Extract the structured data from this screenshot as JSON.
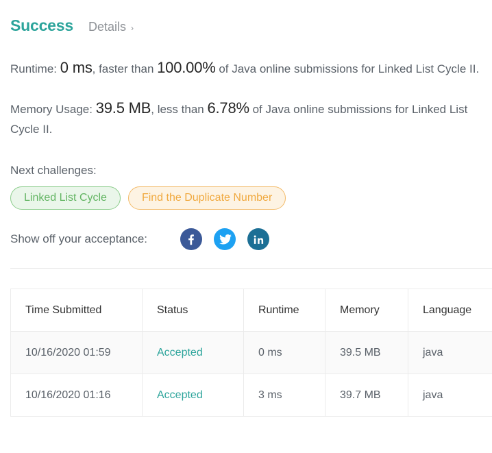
{
  "header": {
    "status": "Success",
    "details_label": "Details",
    "chevron": "›"
  },
  "stats": {
    "runtime": {
      "label": "Runtime:",
      "value": "0 ms",
      "comparator": ", faster than ",
      "percent": "100.00%",
      "suffix": " of Java online submissions for Linked List Cycle II."
    },
    "memory": {
      "label": "Memory Usage:",
      "value": "39.5 MB",
      "comparator": ", less than ",
      "percent": "6.78%",
      "suffix": " of Java online submissions for Linked List Cycle II."
    }
  },
  "next_challenges": {
    "label": "Next challenges:",
    "items": [
      {
        "label": "Linked List Cycle",
        "color": "#63b563",
        "border": "#8ccd8c",
        "background": "#eaf6ea"
      },
      {
        "label": "Find the Duplicate Number",
        "color": "#f0a93f",
        "border": "#f3bb6a",
        "background": "#fdf3e3"
      }
    ]
  },
  "share": {
    "label": "Show off your acceptance:",
    "networks": [
      {
        "name": "facebook-icon",
        "color": "#3b5998"
      },
      {
        "name": "twitter-icon",
        "color": "#1da1f2"
      },
      {
        "name": "linkedin-icon",
        "color": "#1c6f95"
      }
    ]
  },
  "table": {
    "columns": [
      "Time Submitted",
      "Status",
      "Runtime",
      "Memory",
      "Language"
    ],
    "rows": [
      {
        "time": "10/16/2020 01:59",
        "status": "Accepted",
        "runtime": "0 ms",
        "memory": "39.5 MB",
        "language": "java"
      },
      {
        "time": "10/16/2020 01:16",
        "status": "Accepted",
        "runtime": "3 ms",
        "memory": "39.7 MB",
        "language": "java"
      }
    ]
  },
  "colors": {
    "accent_teal": "#2ca49b",
    "body_text": "#5a6169",
    "strong_text": "#262626",
    "muted": "#8d9196",
    "border": "#ebebeb",
    "row_alt": "#fafafa"
  }
}
